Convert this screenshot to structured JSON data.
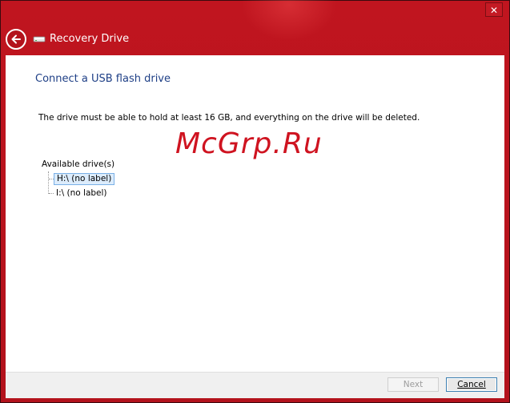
{
  "window": {
    "title": "Recovery Drive",
    "close_glyph": "✕"
  },
  "page": {
    "heading": "Connect a USB flash drive",
    "instruction": "The drive must be able to hold at least 16 GB, and everything on the drive will be deleted.",
    "drives_label": "Available drive(s)",
    "drives": [
      {
        "label": "H:\\ (no label)",
        "selected": true
      },
      {
        "label": "I:\\ (no label)",
        "selected": false
      }
    ]
  },
  "watermark": "McGrp.Ru",
  "buttons": {
    "next": "Next",
    "cancel": "Cancel"
  },
  "icons": {
    "back": "back-arrow-icon",
    "app": "usb-drive-icon",
    "close": "close-icon"
  },
  "colors": {
    "titlebar": "#b3121c",
    "heading": "#1e3f86",
    "watermark": "#cf1320",
    "selection": "#dcecfc"
  }
}
